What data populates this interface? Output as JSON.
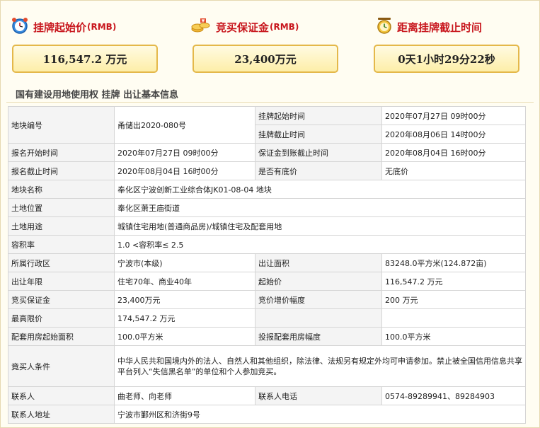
{
  "header": {
    "start_price": {
      "title": "挂牌起始价",
      "suffix": "(RMB)",
      "value": "116,547.2 万元",
      "icon": "alarm-clock-icon"
    },
    "deposit": {
      "title": "竞买保证金",
      "suffix": "(RMB)",
      "value": "23,400万元",
      "icon": "coins-icon"
    },
    "countdown": {
      "title": "距离挂牌截止时间",
      "value": "0天1小时29分22秒",
      "icon": "hourglass-clock-icon"
    }
  },
  "section_title": "国有建设用地使用权 挂牌 出让基本信息",
  "table": {
    "plot_no_label": "地块编号",
    "plot_no": "甬储出2020-080号",
    "listing_start_label": "挂牌起始时间",
    "listing_start": "2020年07月27日 09时00分",
    "listing_end_label": "挂牌截止时间",
    "listing_end": "2020年08月06日 14时00分",
    "reg_start_label": "报名开始时间",
    "reg_start": "2020年07月27日 09时00分",
    "deposit_deadline_label": "保证金到账截止时间",
    "deposit_deadline": "2020年08月04日 16时00分",
    "reg_end_label": "报名截止时间",
    "reg_end": "2020年08月04日 16时00分",
    "reserve_label": "是否有底价",
    "reserve": "无底价",
    "name_label": "地块名称",
    "name": "奉化区宁波创新工业综合体JK01-08-04 地块",
    "location_label": "土地位置",
    "location": "奉化区萧王庙街道",
    "usage_label": "土地用途",
    "usage": "城镇住宅用地(普通商品房)/城镇住宅及配套用地",
    "far_label": "容积率",
    "far": "1.0 <容积率≤ 2.5",
    "district_label": "所属行政区",
    "district": "宁波市(本级)",
    "area_label": "出让面积",
    "area": "83248.0平方米(124.872亩)",
    "term_label": "出让年限",
    "term": "住宅70年、商业40年",
    "start_price_label": "起始价",
    "start_price": "116,547.2 万元",
    "bid_deposit_label": "竞买保证金",
    "bid_deposit": "23,400万元",
    "increment_label": "竞价增价幅度",
    "increment": "200 万元",
    "max_price_label": "最高限价",
    "max_price": "174,547.2 万元",
    "support_area_label": "配套用房起始面积",
    "support_area": "100.0平方米",
    "bid_support_label": "投报配套用房幅度",
    "bid_support": "100.0平方米",
    "conditions_label": "竟买人条件",
    "conditions": "中华人民共和国境内外的法人、自然人和其他组织，除法律、法规另有规定外均可申请参加。禁止被全国信用信息共享平台列入“失信黑名单”的单位和个人参加竞买。",
    "contact_label": "联系人",
    "contact": "曲老师、向老师",
    "phone_label": "联系人电话",
    "phone": "0574-89289941、89284903",
    "address_label": "联系人地址",
    "address": "宁波市鄞州区和济街9号"
  }
}
